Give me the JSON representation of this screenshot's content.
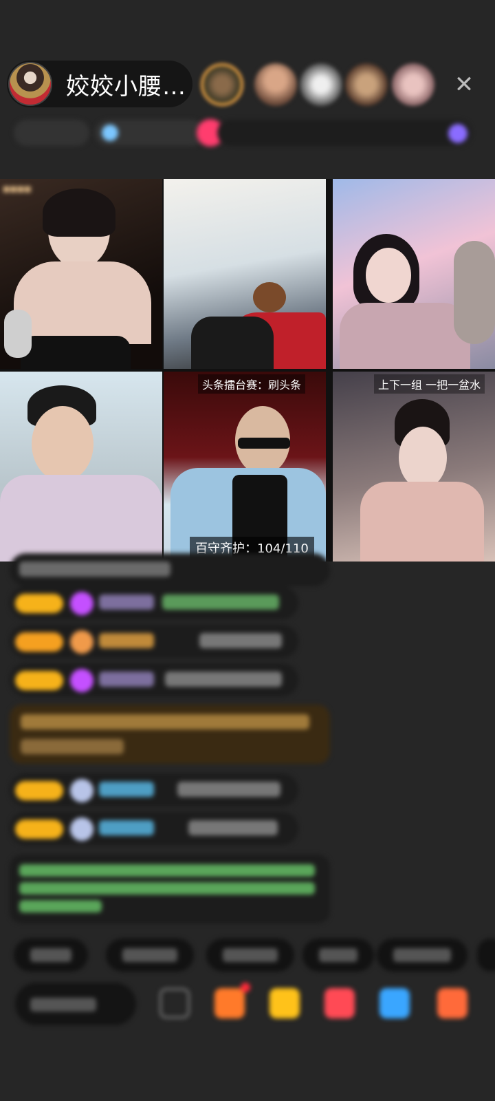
{
  "header": {
    "host_name": "姣姣小腰…",
    "close_label": "✕"
  },
  "video_grid": {
    "cell5_tag": "头条擂台赛：刷头条",
    "cell5_guard": "百守齐护：104/110",
    "cell6_tag": "上下一组 一把一盆水"
  },
  "colors": {
    "background": "#262626",
    "badge": "#f6b21a",
    "accent_pink": "#ff3d6e"
  },
  "icons": [
    "close-icon",
    "gift-icon",
    "heart-icon",
    "share-icon",
    "message-icon"
  ]
}
